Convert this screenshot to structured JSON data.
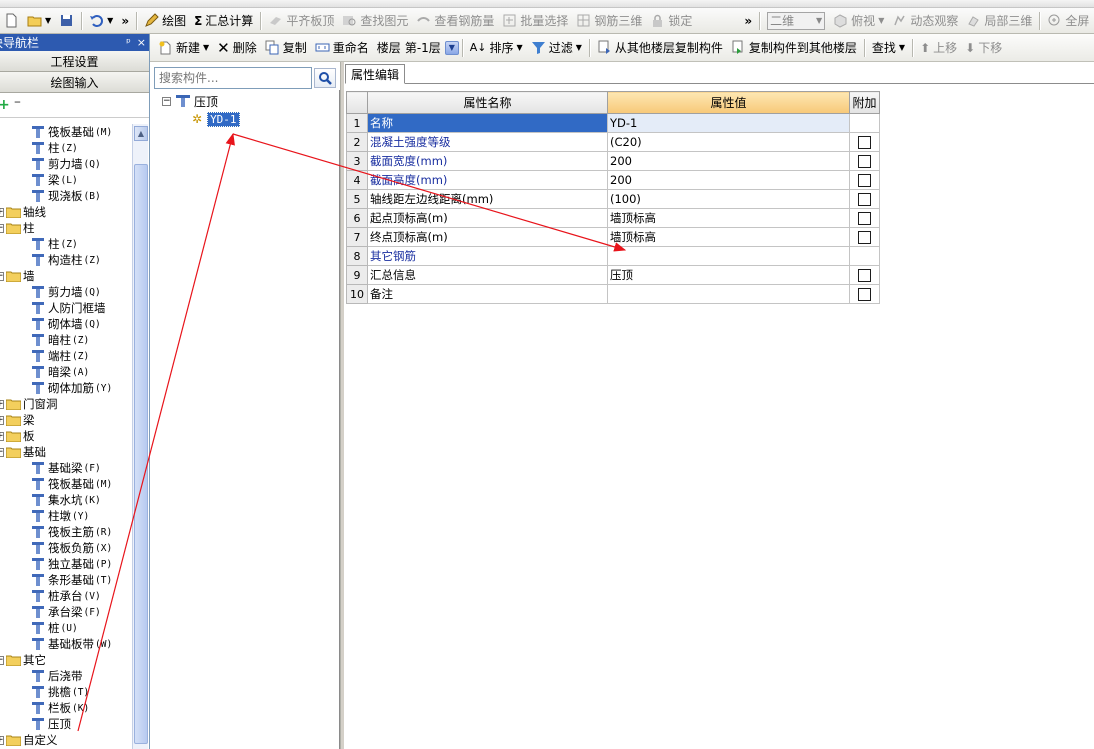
{
  "toolbar1": {
    "items": [
      {
        "label": "绘图",
        "disabled": false
      },
      {
        "label": "汇总计算",
        "disabled": false
      },
      {
        "label": "平齐板顶",
        "disabled": true
      },
      {
        "label": "查找图元",
        "disabled": true
      },
      {
        "label": "查看钢筋量",
        "disabled": true
      },
      {
        "label": "批量选择",
        "disabled": true
      },
      {
        "label": "钢筋三维",
        "disabled": true
      },
      {
        "label": "锁定",
        "disabled": true
      }
    ],
    "view_select": "二维",
    "right_items": [
      {
        "label": "俯视"
      },
      {
        "label": "动态观察"
      },
      {
        "label": "局部三维"
      },
      {
        "label": "全屏"
      }
    ]
  },
  "nav": {
    "title": "模块导航栏",
    "pin_icon": "pin-icon",
    "close_label": "×",
    "project_settings": "工程设置",
    "drawing_input": "绘图输入",
    "tree": [
      {
        "type": "leaf",
        "label": "筏板基础",
        "key": "(M)",
        "icon": "raft-icon"
      },
      {
        "type": "leaf",
        "label": "柱",
        "key": "(Z)",
        "icon": "column-icon"
      },
      {
        "type": "leaf",
        "label": "剪力墙",
        "key": "(Q)",
        "icon": "wall-icon"
      },
      {
        "type": "leaf",
        "label": "梁",
        "key": "(L)",
        "icon": "beam-icon"
      },
      {
        "type": "leaf",
        "label": "现浇板",
        "key": "(B)",
        "icon": "slab-icon"
      },
      {
        "type": "folder",
        "label": "轴线",
        "expanded": false
      },
      {
        "type": "folder",
        "label": "柱",
        "expanded": true
      },
      {
        "type": "leaf",
        "label": "柱",
        "key": "(Z)",
        "icon": "column-icon"
      },
      {
        "type": "leaf",
        "label": "构造柱",
        "key": "(Z)",
        "icon": "constructional-column-icon"
      },
      {
        "type": "folder",
        "label": "墙",
        "expanded": true
      },
      {
        "type": "leaf",
        "label": "剪力墙",
        "key": "(Q)",
        "icon": "wall-icon"
      },
      {
        "type": "leaf",
        "label": "人防门框墙",
        "key": "",
        "icon": "door-frame-wall-icon"
      },
      {
        "type": "leaf",
        "label": "砌体墙",
        "key": "(Q)",
        "icon": "masonry-wall-icon"
      },
      {
        "type": "leaf",
        "label": "暗柱",
        "key": "(Z)",
        "icon": "column-icon"
      },
      {
        "type": "leaf",
        "label": "端柱",
        "key": "(Z)",
        "icon": "column-icon"
      },
      {
        "type": "leaf",
        "label": "暗梁",
        "key": "(A)",
        "icon": "hidden-beam-icon"
      },
      {
        "type": "leaf",
        "label": "砌体加筋",
        "key": "(Y)",
        "icon": "masonry-rebar-icon"
      },
      {
        "type": "folder",
        "label": "门窗洞",
        "expanded": false
      },
      {
        "type": "folder",
        "label": "梁",
        "expanded": false
      },
      {
        "type": "folder",
        "label": "板",
        "expanded": false
      },
      {
        "type": "folder",
        "label": "基础",
        "expanded": true
      },
      {
        "type": "leaf",
        "label": "基础梁",
        "key": "(F)",
        "icon": "foundation-beam-icon"
      },
      {
        "type": "leaf",
        "label": "筏板基础",
        "key": "(M)",
        "icon": "raft-icon"
      },
      {
        "type": "leaf",
        "label": "集水坑",
        "key": "(K)",
        "icon": "sump-icon"
      },
      {
        "type": "leaf",
        "label": "柱墩",
        "key": "(Y)",
        "icon": "column-pier-icon"
      },
      {
        "type": "leaf",
        "label": "筏板主筋",
        "key": "(R)",
        "icon": "raft-main-rebar-icon"
      },
      {
        "type": "leaf",
        "label": "筏板负筋",
        "key": "(X)",
        "icon": "raft-neg-rebar-icon"
      },
      {
        "type": "leaf",
        "label": "独立基础",
        "key": "(P)",
        "icon": "isolated-footing-icon"
      },
      {
        "type": "leaf",
        "label": "条形基础",
        "key": "(T)",
        "icon": "strip-footing-icon"
      },
      {
        "type": "leaf",
        "label": "桩承台",
        "key": "(V)",
        "icon": "pile-cap-icon"
      },
      {
        "type": "leaf",
        "label": "承台梁",
        "key": "(F)",
        "icon": "cap-beam-icon"
      },
      {
        "type": "leaf",
        "label": "桩",
        "key": "(U)",
        "icon": "pile-icon"
      },
      {
        "type": "leaf",
        "label": "基础板带",
        "key": "(W)",
        "icon": "foundation-strip-icon"
      },
      {
        "type": "folder",
        "label": "其它",
        "expanded": true
      },
      {
        "type": "leaf",
        "label": "后浇带",
        "key": "",
        "icon": "post-pour-strip-icon"
      },
      {
        "type": "leaf",
        "label": "挑檐",
        "key": "(T)",
        "icon": "eave-icon"
      },
      {
        "type": "leaf",
        "label": "栏板",
        "key": "(K)",
        "icon": "parapet-icon"
      },
      {
        "type": "leaf",
        "label": "压顶",
        "key": "",
        "icon": "coping-icon"
      },
      {
        "type": "folder",
        "label": "自定义",
        "expanded": false
      }
    ]
  },
  "toolbar2": {
    "new": "新建",
    "delete": "删除",
    "copy": "复制",
    "rename": "重命名",
    "floor_label": "楼层",
    "floor_value": "第-1层",
    "sort": "排序",
    "filter": "过滤",
    "copy_from_other": "从其他楼层复制构件",
    "copy_to_other": "复制构件到其他楼层",
    "find": "查找",
    "move_up": "上移",
    "move_down": "下移"
  },
  "search": {
    "placeholder": "搜索构件..."
  },
  "component_tree": {
    "root": "压顶",
    "child": "YD-1"
  },
  "property_editor": {
    "tab": "属性编辑",
    "columns": {
      "name": "属性名称",
      "value": "属性值",
      "add": "附加"
    },
    "rows": [
      {
        "num": "1",
        "name": "名称",
        "value": "YD-1",
        "blue": false,
        "checkbox": false,
        "selected": true
      },
      {
        "num": "2",
        "name": "混凝土强度等级",
        "value": "(C20)",
        "blue": true,
        "checkbox": true
      },
      {
        "num": "3",
        "name": "截面宽度(mm)",
        "value": "200",
        "blue": true,
        "checkbox": true
      },
      {
        "num": "4",
        "name": "截面高度(mm)",
        "value": "200",
        "blue": true,
        "checkbox": true
      },
      {
        "num": "5",
        "name": "轴线距左边线距离(mm)",
        "value": "(100)",
        "blue": false,
        "checkbox": true
      },
      {
        "num": "6",
        "name": "起点顶标高(m)",
        "value": "墙顶标高",
        "blue": false,
        "checkbox": true
      },
      {
        "num": "7",
        "name": "终点顶标高(m)",
        "value": "墙顶标高",
        "blue": false,
        "checkbox": true
      },
      {
        "num": "8",
        "name": "其它钢筋",
        "value": "",
        "blue": true,
        "checkbox": false
      },
      {
        "num": "9",
        "name": "汇总信息",
        "value": "压顶",
        "blue": false,
        "checkbox": true
      },
      {
        "num": "10",
        "name": "备注",
        "value": "",
        "blue": false,
        "checkbox": true
      }
    ]
  },
  "colors": {
    "nav_title_bg": "#2d5ab0",
    "selection_bg": "#316ac5",
    "header_highlight": "#f7c878",
    "annotation_arrow": "#e8141b",
    "property_blue": "#1a2fa0"
  }
}
